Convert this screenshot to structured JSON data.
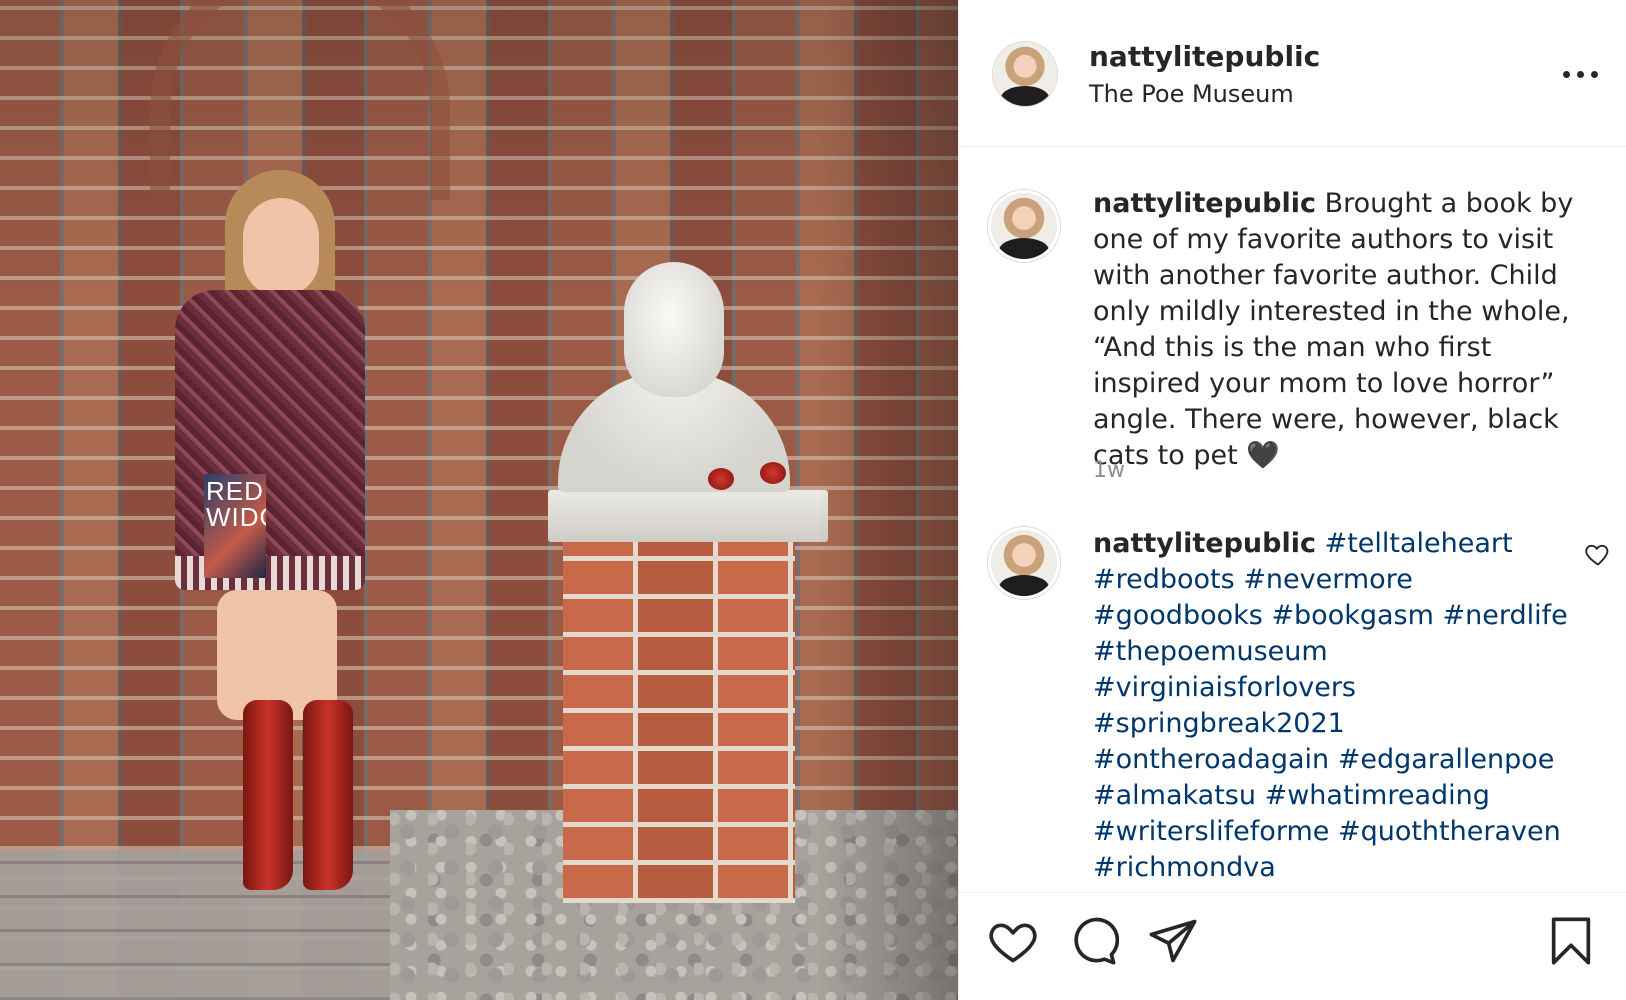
{
  "post": {
    "username": "nattylitepublic",
    "location": "The Poe Museum",
    "more_icon": "more-options-icon"
  },
  "photo": {
    "book_title": "RED\nWIDOW"
  },
  "caption": {
    "username": "nattylitepublic",
    "text": "Brought a book by one of my favorite authors to visit with another favorite author. Child only mildly interested in the whole, “And this is the man who first inspired your mom to love horror” angle. There were, however, black cats to pet 🖤",
    "time": "1w"
  },
  "hashtag_comment": {
    "username": "nattylitepublic",
    "tags": [
      "#telltaleheart",
      "#redboots",
      "#nevermore",
      "#goodbooks",
      "#bookgasm",
      "#nerdlife",
      "#thepoemuseum",
      "#virginiaisforlovers",
      "#springbreak2021",
      "#ontheroadagain",
      "#edgarallenpoe",
      "#almakatsu",
      "#whatimreading",
      "#writerslifeforme",
      "#quoththeraven",
      "#richmondva"
    ]
  },
  "actions": {
    "icons": [
      "heart-icon",
      "comment-icon",
      "share-icon",
      "save-icon"
    ]
  },
  "colors": {
    "text": "#262626",
    "hashtag": "#00376b",
    "muted": "#8e8e8e",
    "divider": "#efefef"
  }
}
